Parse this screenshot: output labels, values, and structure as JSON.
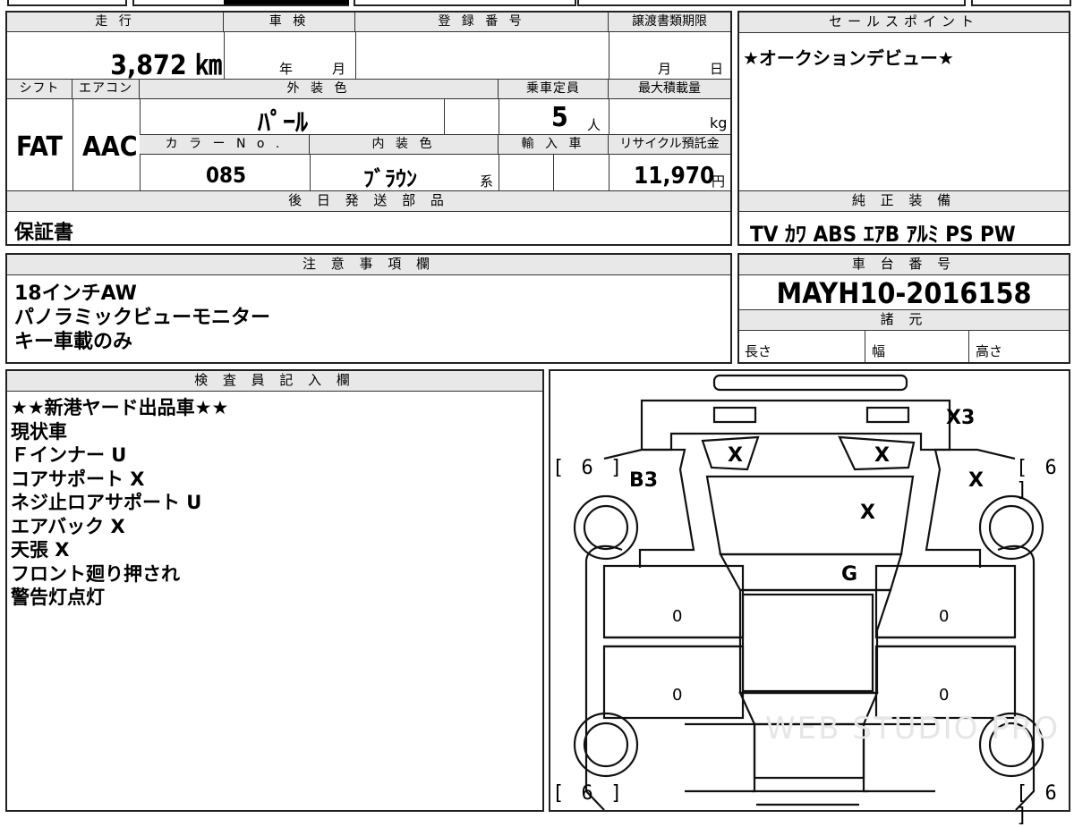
{
  "top_header": {
    "mileage_label": "走 行",
    "shaken_label": "車 検",
    "registration_label": "登 録 番 号",
    "transfer_deadline_label": "譲渡書類期限",
    "mileage_value": "3,872 ㎞",
    "shaken_year_unit": "年",
    "shaken_month_unit": "月",
    "transfer_month_unit": "月",
    "transfer_day_unit": "日"
  },
  "specs": {
    "shift_label": "シフト",
    "ac_label": "エアコン",
    "exterior_color_label": "外 装 色",
    "capacity_label": "乗車定員",
    "max_load_label": "最大積載量",
    "shift_value": "FAT",
    "ac_value": "AAC",
    "exterior_color_value": "ﾊﾟｰﾙ",
    "capacity_value": "5",
    "capacity_unit": "人",
    "max_load_unit": "kg",
    "color_no_label": "カ ラ ー N o .",
    "interior_color_label": "内 装 色",
    "import_label": "輸 入 車",
    "recycle_label": "リサイクル預託金",
    "color_no_value": "085",
    "interior_color_value": "ﾌﾞﾗｳﾝ",
    "interior_color_suffix": "系",
    "recycle_value": "11,970",
    "recycle_unit": "円"
  },
  "later_parts": {
    "label": "後 日 発 送 部 品",
    "value": "保証書"
  },
  "sales_point": {
    "label": "セールスポイント",
    "value": "★オークションデビュー★"
  },
  "equipment": {
    "label": "純 正 装 備",
    "value": "TV ｶﾜ ABS ｴｱB ｱﾙﾐ PS PW"
  },
  "notes": {
    "label": "注 意 事 項 欄",
    "lines": [
      "18インチAW",
      "パノラミックビューモニター",
      "キー車載のみ"
    ]
  },
  "chassis": {
    "label": "車 台 番 号",
    "value": "MAYH10-2016158",
    "specs_label": "諸 元",
    "length_label": "長さ",
    "width_label": "幅",
    "height_label": "高さ"
  },
  "inspector": {
    "label": "検 査 員 記 入 欄",
    "lines": [
      "★★新港ヤード出品車★★",
      "現状車",
      "Ｆインナー U",
      "コアサポート X",
      "ネジ止ロアサポート U",
      "エアバック X",
      "天張 X",
      "フロント廻り押され",
      "警告灯点灯"
    ]
  },
  "diagram": {
    "marks": {
      "x3": "X3",
      "b3": "B3",
      "x_left_light": "X",
      "x_right_light": "X",
      "x_right_fender": "X",
      "x_hood": "X",
      "g_windshield": "G",
      "zero_left_front": "0",
      "zero_left_rear": "0",
      "zero_right_front": "0",
      "zero_right_rear": "0"
    },
    "tires": {
      "front_left": "[ 6 ]",
      "front_right": "[ 6 ]",
      "rear_left": "[ 6 ]",
      "rear_right": "[ 6 ]"
    },
    "watermark": "WEB STUDIO PRO"
  }
}
